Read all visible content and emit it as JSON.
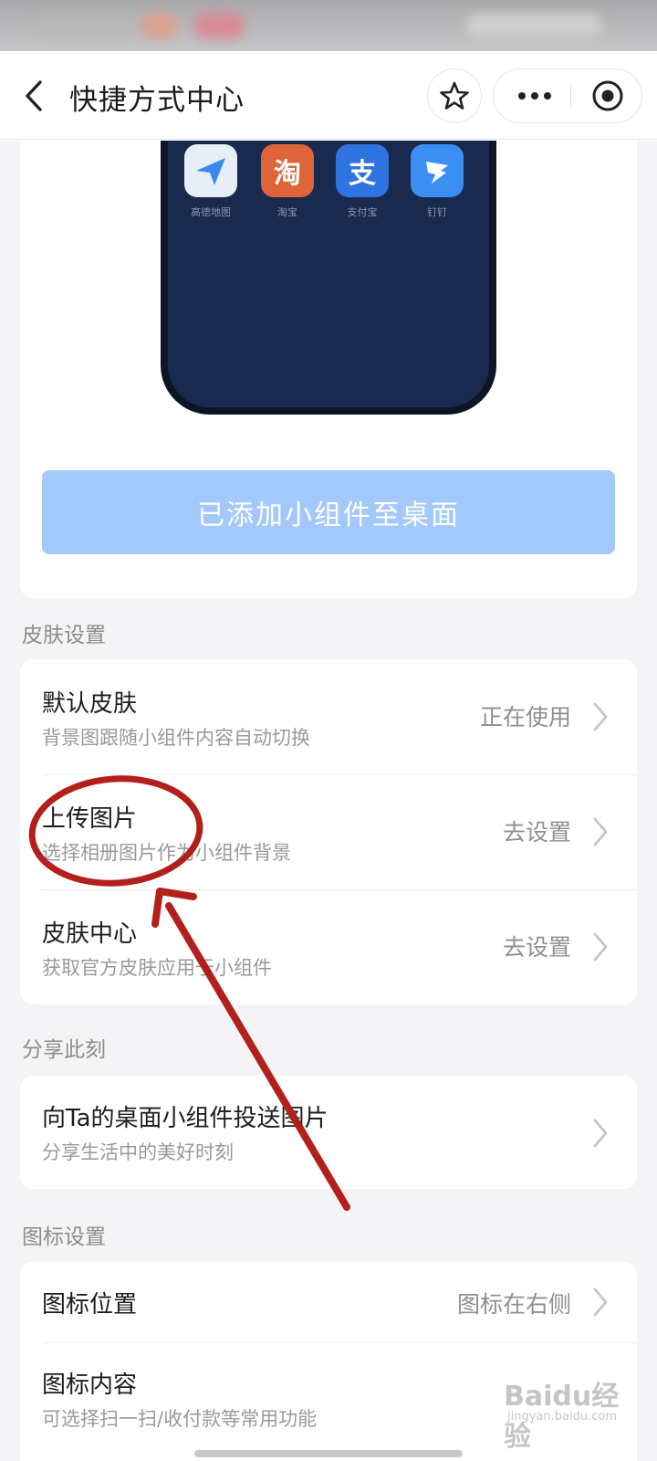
{
  "header": {
    "title": "快捷方式中心",
    "icons": [
      "back-icon",
      "star-icon",
      "more-icon",
      "close-icon"
    ]
  },
  "preview": {
    "apps": [
      {
        "label": "高德地图",
        "glyph": "",
        "icon": "amap-icon",
        "color": "#3a8bf0"
      },
      {
        "label": "淘宝",
        "glyph": "淘",
        "icon": "taobao-icon",
        "color": "#e0643a"
      },
      {
        "label": "支付宝",
        "glyph": "支",
        "icon": "alipay-icon",
        "color": "#2f74e0"
      },
      {
        "label": "钉钉",
        "glyph": "",
        "icon": "dingtalk-icon",
        "color": "#3b8ff2"
      }
    ]
  },
  "add_button": {
    "label": "已添加小组件至桌面",
    "color": "#a3c8fb"
  },
  "skin_section": {
    "header": "皮肤设置",
    "items": [
      {
        "title": "默认皮肤",
        "subtitle": "背景图跟随小组件内容自动切换",
        "value": "正在使用"
      },
      {
        "title": "上传图片",
        "subtitle": "选择相册图片作为小组件背景",
        "value": "去设置"
      },
      {
        "title": "皮肤中心",
        "subtitle": "获取官方皮肤应用于小组件",
        "value": "去设置"
      }
    ]
  },
  "share_section": {
    "header": "分享此刻",
    "items": [
      {
        "title": "向Ta的桌面小组件投送图片",
        "subtitle": "分享生活中的美好时刻"
      }
    ]
  },
  "icon_section": {
    "header": "图标设置",
    "items": [
      {
        "title": "图标位置",
        "value": "图标在右侧"
      },
      {
        "title": "图标内容",
        "subtitle": "可选择扫一扫/收付款等常用功能"
      }
    ]
  },
  "annotation_color": "#b3201c",
  "watermark": {
    "main": "Baidu经验",
    "sub": "jingyan.baidu.com"
  }
}
